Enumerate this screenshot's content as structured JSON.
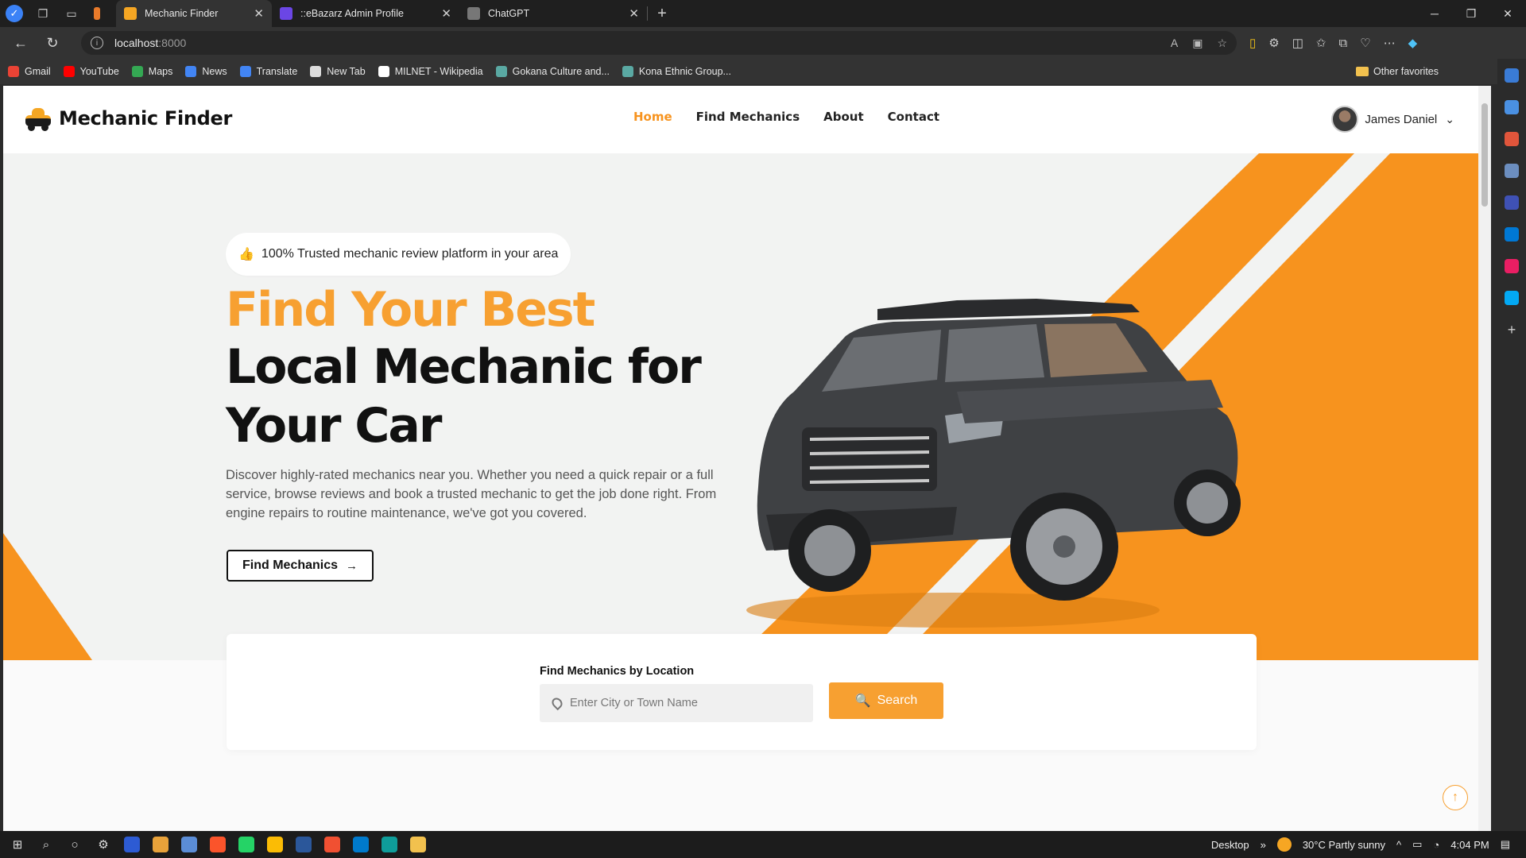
{
  "browser": {
    "tabs": [
      {
        "label": "",
        "favicon_color": "#e87a2a"
      },
      {
        "label": "Mechanic Finder",
        "favicon_color": "#f5a623",
        "active": true
      },
      {
        "label": "::eBazarz Admin Profile",
        "favicon_color": "#6b46e5"
      },
      {
        "label": "ChatGPT",
        "favicon_color": "#777777"
      }
    ],
    "new_tab_label": "+",
    "url_host": "localhost",
    "url_port": ":8000",
    "bookmarks": [
      {
        "label": "Gmail",
        "color": "#ea4335"
      },
      {
        "label": "YouTube",
        "color": "#ff0000"
      },
      {
        "label": "Maps",
        "color": "#34a853"
      },
      {
        "label": "News",
        "color": "#4285f4"
      },
      {
        "label": "Translate",
        "color": "#4285f4"
      },
      {
        "label": "New Tab",
        "color": "#dddddd"
      },
      {
        "label": "MILNET - Wikipedia",
        "color": "#ffffff"
      },
      {
        "label": "Gokana Culture and...",
        "color": "#5aa9a3"
      },
      {
        "label": "Kona Ethnic Group...",
        "color": "#5aa9a3"
      }
    ],
    "other_favorites": "Other favorites"
  },
  "site": {
    "brand": "Mechanic Finder",
    "nav": [
      {
        "label": "Home",
        "active": true
      },
      {
        "label": "Find Mechanics"
      },
      {
        "label": "About"
      },
      {
        "label": "Contact"
      }
    ],
    "user_name": "James Daniel",
    "hero": {
      "badge": "100% Trusted mechanic review platform in your area",
      "title_line1": "Find Your Best",
      "title_line2": "Local Mechanic for",
      "title_line3": "Your Car",
      "description": "Discover highly-rated mechanics near you. Whether you need a quick repair or a full service, browse reviews and book a trusted mechanic to get the job done right. From engine repairs to routine maintenance, we've got you covered.",
      "cta_label": "Find Mechanics",
      "accent_color": "#f7931e"
    },
    "search": {
      "label": "Find Mechanics by Location",
      "placeholder": "Enter City or Town Name",
      "button_label": "Search"
    }
  },
  "taskbar": {
    "desktop_label": "Desktop",
    "weather": "30°C  Partly sunny",
    "time": "4:04 PM"
  }
}
